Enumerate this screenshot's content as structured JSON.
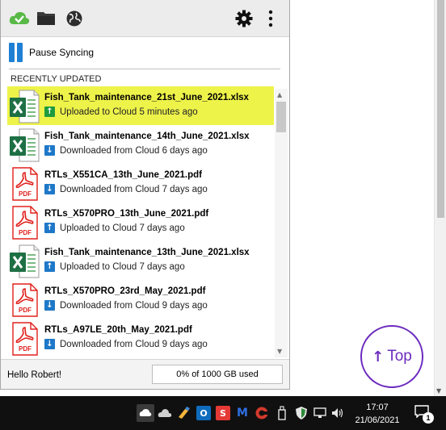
{
  "panel": {
    "pause_label": "Pause Syncing",
    "recent_title": "RECENTLY UPDATED",
    "files": [
      {
        "name": "Fish_Tank_maintenance_21st_June_2021.xlsx",
        "type": "xlsx",
        "status": "Uploaded to Cloud 5 minutes ago",
        "direction": "up",
        "highlight": true
      },
      {
        "name": "Fish_Tank_maintenance_14th_June_2021.xlsx",
        "type": "xlsx",
        "status": "Downloaded from Cloud 6 days ago",
        "direction": "down"
      },
      {
        "name": "RTLs_X551CA_13th_June_2021.pdf",
        "type": "pdf",
        "status": "Downloaded from Cloud 7 days ago",
        "direction": "down"
      },
      {
        "name": "RTLs_X570PRO_13th_June_2021.pdf",
        "type": "pdf",
        "status": "Uploaded to Cloud 7 days ago",
        "direction": "up-blue"
      },
      {
        "name": "Fish_Tank_maintenance_13th_June_2021.xlsx",
        "type": "xlsx",
        "status": "Uploaded to Cloud 7 days ago",
        "direction": "up-blue"
      },
      {
        "name": "RTLs_X570PRO_23rd_May_2021.pdf",
        "type": "pdf",
        "status": "Downloaded from Cloud 9 days ago",
        "direction": "down"
      },
      {
        "name": "RTLs_A97LE_20th_May_2021.pdf",
        "type": "pdf",
        "status": "Downloaded from Cloud 9 days ago",
        "direction": "down"
      }
    ],
    "greeting": "Hello Robert!",
    "quota_text": "0% of 1000 GB  used",
    "quota_fraction": 0
  },
  "top_button": {
    "label": "Top"
  },
  "taskbar": {
    "time": "17:07",
    "date": "21/06/2021",
    "notification_count": "1"
  },
  "colors": {
    "highlight": "#eef34a",
    "accent_blue": "#1e78c8",
    "upload_green": "#1e9b3e",
    "excel_green": "#1d7044",
    "pdf_red": "#e0201b",
    "top_button_purple": "#6b2bbf"
  }
}
